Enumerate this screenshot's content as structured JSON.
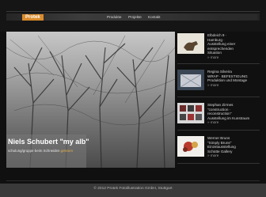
{
  "header": {
    "logo": "Protek",
    "nav": [
      "Produkte",
      "Projekte",
      "Kontakt"
    ],
    "search_placeholder": ""
  },
  "hero": {
    "title": "Niels Schubert \"my alb\"",
    "subtitle": "schulung/gruppe·beim Schneiden",
    "link": "gelesen"
  },
  "teasers": [
    {
      "line1": "Elbdeich 9 ·",
      "line2": "Hamburg ·",
      "line3": "Ausstellung einer entsprechenden",
      "line4": "Situation",
      "more": "» more"
    },
    {
      "line1": "Regina Silveira",
      "line2": "WRAP · BEFESTIGUNG",
      "line3": "Produktion und Montage",
      "line4": "",
      "more": "» more"
    },
    {
      "line1": "Stephan Zirmes",
      "line2": "\"construction ·",
      "line3": "reconstruction\"",
      "line4": "Ausstellung im Kunstraum",
      "more": "» more"
    },
    {
      "line1": "Werner Bruns",
      "line2": "\"Simply Bruns\"",
      "line3": "Einzelausstellung",
      "line4": "Schütte Gallery",
      "more": "» more"
    }
  ],
  "footer": {
    "text": "© 2012 Protek Fotoillustration GmbH, Stuttgart"
  },
  "colors": {
    "accent": "#d98b2b",
    "link": "#e0b24a",
    "background": "#101010"
  }
}
